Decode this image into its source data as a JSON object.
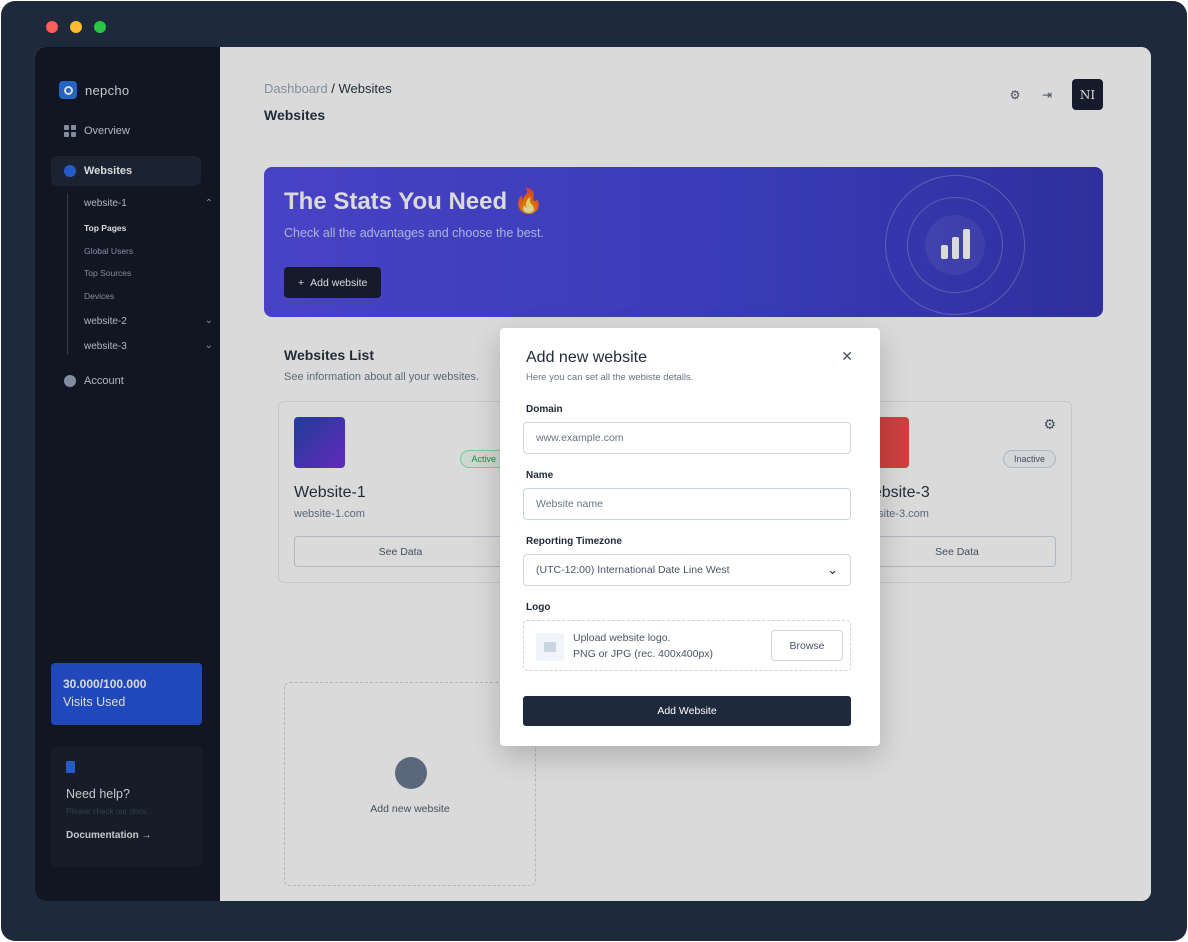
{
  "sidebar": {
    "logo": "nepcho",
    "items": [
      {
        "label": "Overview",
        "icon": "grid-icon"
      },
      {
        "label": "Websites",
        "icon": "globe-icon"
      },
      {
        "label": "Account",
        "icon": "user-icon"
      }
    ],
    "sites": [
      {
        "label": "website-1",
        "expanded": true,
        "children": [
          "Top Pages",
          "Global Users",
          "Top Sources",
          "Devices"
        ]
      },
      {
        "label": "website-2",
        "expanded": false
      },
      {
        "label": "website-3",
        "expanded": false
      }
    ],
    "usage": {
      "count": "30.000/100.000",
      "label": "Visits Used"
    },
    "help": {
      "title": "Need help?",
      "subtitle": "Please check our docs.",
      "link": "Documentation →"
    }
  },
  "header": {
    "breadcrumb_root": "Dashboard",
    "breadcrumb_sep": "/",
    "breadcrumb_current": "Websites",
    "title": "Websites",
    "avatar": "NI"
  },
  "hero": {
    "title": "The Stats You Need 🔥",
    "subtitle": "Check all the advantages and choose the best.",
    "button": "Add website"
  },
  "list": {
    "title": "Websites List",
    "subtitle": "See information about all your websites.",
    "cards": [
      {
        "name": "Website-1",
        "url": "website-1.com",
        "status": "Active",
        "button": "See Data",
        "color": "#5b21b6"
      },
      {
        "name": "Website-3",
        "url": "website-3.com",
        "status": "Inactive",
        "button": "See Data",
        "color": "#ef4444"
      }
    ],
    "add_label": "Add new website"
  },
  "modal": {
    "title": "Add new website",
    "subtitle": "Here you can set all the webiste details.",
    "domain_label": "Domain",
    "domain_placeholder": "www.example.com",
    "name_label": "Name",
    "name_placeholder": "Website name",
    "timezone_label": "Reporting Timezone",
    "timezone_value": "(UTC-12:00) International Date Line West",
    "logo_label": "Logo",
    "upload_line1": "Upload website logo.",
    "upload_line2": "PNG or JPG (rec. 400x400px)",
    "browse": "Browse",
    "submit": "Add Website"
  },
  "colors": {
    "accent": "#1d4ed8",
    "hero": "#4f46e5",
    "dark": "#0b1120"
  }
}
